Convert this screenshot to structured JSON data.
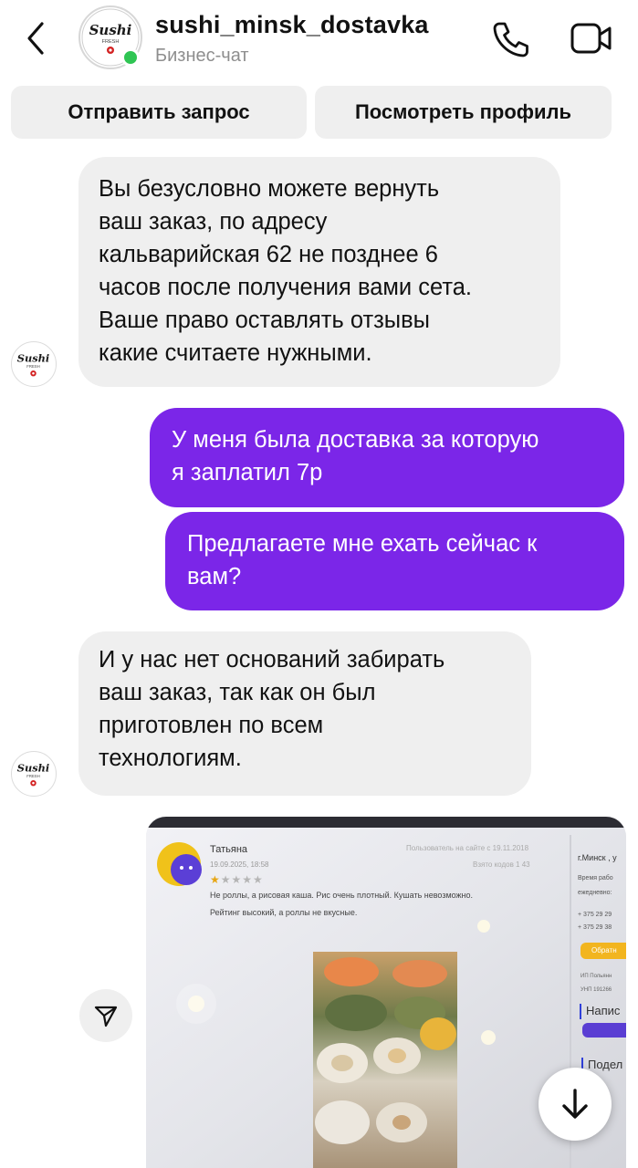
{
  "header": {
    "username": "sushi_minsk_dostavka",
    "subtitle": "Бизнес-чат",
    "send_request_label": "Отправить запрос",
    "view_profile_label": "Посмотреть профиль",
    "icons": [
      "back-arrow-icon",
      "phone-icon",
      "video-call-icon"
    ],
    "online_color": "#2fc553"
  },
  "logo": {
    "text": "Sushi",
    "subtext": "FRESH"
  },
  "messages": [
    {
      "side": "in",
      "text": "Вы безусловно можете вернуть ваш заказ, по адресу кальварийская 62 не позднее 6 часов после получения вами сета. Ваше право оставлять отзывы какие считаете нужными.",
      "lines": [
        "Вы безусловно можете вернуть",
        "ваш заказ, по адресу",
        "кальварийская 62 не позднее 6",
        "часов после получения вами сета.",
        "Ваше право оставлять отзывы",
        "какие считаете нужными."
      ]
    },
    {
      "side": "out",
      "lines": [
        "У меня была доставка за которую",
        "я заплатил 7р"
      ]
    },
    {
      "side": "out",
      "lines": [
        "Предлагаете мне ехать сейчас к",
        "вам?"
      ]
    },
    {
      "side": "in",
      "lines": [
        "И у нас нет оснований забирать",
        "ваш заказ, так как он был",
        "приготовлен по всем",
        "технологиям."
      ]
    }
  ],
  "photo": {
    "reviewer_name": "Татьяна",
    "review_date": "19.09.2025, 18:58",
    "user_since": "Пользователь на сайте с 19.11.2018",
    "visit_code": "Взято кодов",
    "visit_count": "1",
    "visit_total": "43",
    "stars": "★★★★★",
    "review_line1": "Не роллы, а рисовая каша. Рис очень плотный. Кушать невозможно.",
    "review_line2": "Рейтинг высокий, а роллы не вкусные.",
    "side_city": "г.Минск , у",
    "side_hours": "Время рабо",
    "side_daily": "ежедневно:",
    "side_phone1": "+ 375 29 29",
    "side_phone2": "+ 375 29 38",
    "side_feedback": "Обратн",
    "side_ip": "ИП Польянн",
    "side_unp": "УНП 191266",
    "side_write": "Напис",
    "side_share": "Подел"
  },
  "colors": {
    "outgoing_bubble": "#7b26e8",
    "incoming_bubble": "#efefef"
  },
  "controls": {
    "share_icon": "send-paper-plane-icon",
    "scroll_icon": "arrow-down-icon"
  }
}
